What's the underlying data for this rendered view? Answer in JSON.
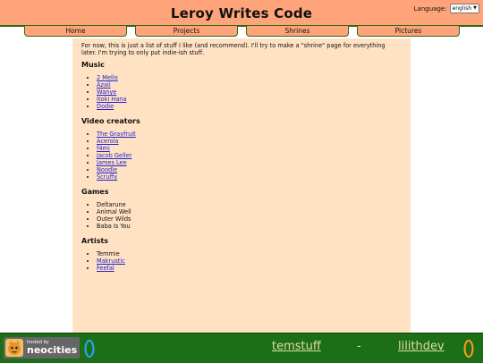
{
  "site": {
    "title": "Leroy Writes Code"
  },
  "language": {
    "label": "Language:",
    "selected": "english"
  },
  "nav": [
    {
      "label": "Home"
    },
    {
      "label": "Projects"
    },
    {
      "label": "Shrines"
    },
    {
      "label": "Pictures"
    }
  ],
  "intro": "For now, this is just a list of stuff I like (and recommend). I'll try to make a \"shrine\" page for everything later. I'm trying to only put indie-ish stuff.",
  "sections": [
    {
      "heading": "Music",
      "items": [
        "2 Mello",
        "Azali",
        "Wanye",
        "Itoki Hana",
        "Dodie"
      ]
    },
    {
      "heading": "Video creators",
      "items": [
        "The Grayfruit",
        "Acerola",
        "f4mi",
        "Jacob Geller",
        "James Lee",
        "Noodle",
        "Scruffy"
      ]
    },
    {
      "heading": "Games",
      "items": [
        "Deltarune",
        "Animal Well",
        "Outer Wilds",
        "Baba Is You"
      ]
    },
    {
      "heading": "Artists",
      "items": [
        "Temmie",
        "Makrustic",
        "Feefal"
      ]
    }
  ],
  "footer": {
    "badge_small": "hosted by",
    "badge_big": "neocities",
    "webring_left": "temstuff",
    "webring_sep": "-",
    "webring_right": "lilithdev"
  },
  "colors": {
    "header": "#ffa47a",
    "panel": "#ffe2c4",
    "footer": "#1c6f16",
    "link": "#2222cc"
  }
}
